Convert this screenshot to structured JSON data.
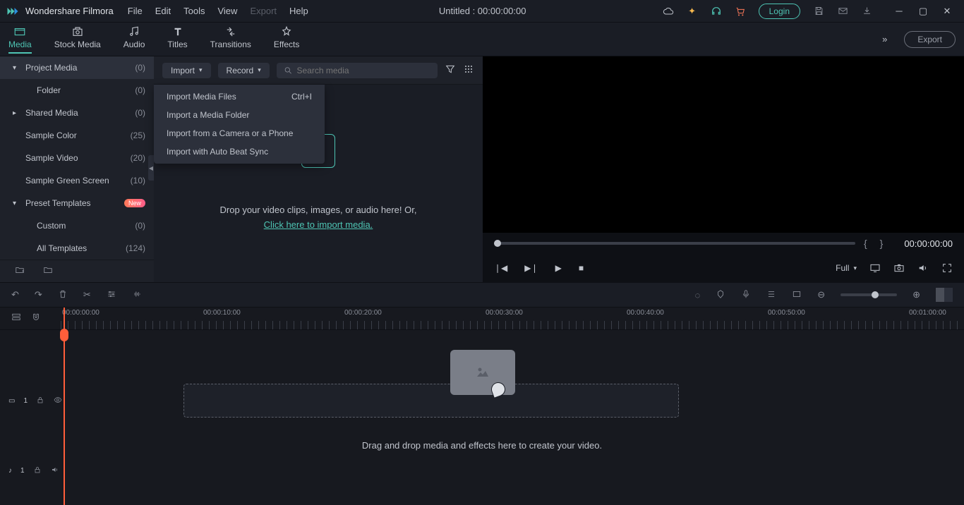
{
  "app": {
    "name": "Wondershare Filmora",
    "title": "Untitled : 00:00:00:00"
  },
  "menu": {
    "file": "File",
    "edit": "Edit",
    "tools": "Tools",
    "view": "View",
    "export": "Export",
    "help": "Help"
  },
  "title_icons": {
    "login": "Login"
  },
  "top_tabs": {
    "media": "Media",
    "stock": "Stock Media",
    "audio": "Audio",
    "titles": "Titles",
    "transitions": "Transitions",
    "effects": "Effects"
  },
  "export_btn": "Export",
  "sidebar": {
    "items": [
      {
        "label": "Project Media",
        "count": "(0)"
      },
      {
        "label": "Folder",
        "count": "(0)"
      },
      {
        "label": "Shared Media",
        "count": "(0)"
      },
      {
        "label": "Sample Color",
        "count": "(25)"
      },
      {
        "label": "Sample Video",
        "count": "(20)"
      },
      {
        "label": "Sample Green Screen",
        "count": "(10)"
      },
      {
        "label": "Preset Templates",
        "badge": "New"
      },
      {
        "label": "Custom",
        "count": "(0)"
      },
      {
        "label": "All Templates",
        "count": "(124)"
      }
    ]
  },
  "media_toolbar": {
    "import": "Import",
    "record": "Record",
    "search_placeholder": "Search media"
  },
  "import_menu": {
    "files": "Import Media Files",
    "files_key": "Ctrl+I",
    "folder": "Import a Media Folder",
    "camera": "Import from a Camera or a Phone",
    "beat": "Import with Auto Beat Sync"
  },
  "drop": {
    "line1": "Drop your video clips, images, or audio here! Or,",
    "link": "Click here to import media."
  },
  "preview": {
    "timecode": "00:00:00:00",
    "quality": "Full"
  },
  "ruler": [
    "00:00:00:00",
    "00:00:10:00",
    "00:00:20:00",
    "00:00:30:00",
    "00:00:40:00",
    "00:00:50:00",
    "00:01:00:00"
  ],
  "timeline": {
    "hint": "Drag and drop media and effects here to create your video.",
    "track_video": "1",
    "track_audio": "1"
  }
}
